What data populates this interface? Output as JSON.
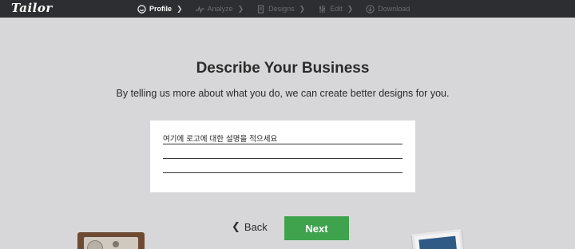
{
  "app": {
    "logo": "Tailor"
  },
  "steps": [
    {
      "label": "Profile",
      "icon": "smiley-icon",
      "active": true
    },
    {
      "label": "Analyze",
      "icon": "pulse-icon",
      "active": false
    },
    {
      "label": "Designs",
      "icon": "file-icon",
      "active": false
    },
    {
      "label": "Edit",
      "icon": "sliders-icon",
      "active": false
    },
    {
      "label": "Download",
      "icon": "download-icon",
      "active": false
    }
  ],
  "main": {
    "title": "Describe Your Business",
    "subtitle": "By telling us more about what you do, we can create better designs for you."
  },
  "description": {
    "value": "여기에 로고에 대한 설명을 적으세요"
  },
  "nav": {
    "back_label": "Back",
    "next_label": "Next"
  },
  "colors": {
    "topbar": "#2c2e31",
    "background": "#d7d7d9",
    "next_button": "#3fa34d"
  }
}
